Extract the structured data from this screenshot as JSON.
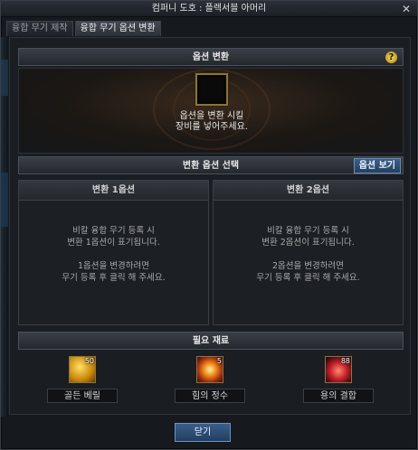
{
  "window": {
    "title": "컴퍼니 도호 : 플렉서블 아머리",
    "close_symbol": "✕"
  },
  "tabs": [
    {
      "label": "융합 무기 제작",
      "active": false
    },
    {
      "label": "융합 무기 옵션 변환",
      "active": true
    }
  ],
  "option_convert": {
    "title": "옵션 변환",
    "help_symbol": "?",
    "hint_line1": "옵션을 변환 시킬",
    "hint_line2": "장비를 넣어주세요."
  },
  "option_select": {
    "title": "변환 옵션 선택",
    "view_button": "옵션 보기",
    "boxes": [
      {
        "title": "변환 1옵션",
        "line1": "비칼 융합 무기 등록 시",
        "line2": "변환 1옵션이 표기됩니다.",
        "line3": "1옵션을 변경하려면",
        "line4": "무기 등록 후 클릭 해 주세요."
      },
      {
        "title": "변환 2옵션",
        "line1": "비칼 융합 무기 등록 시",
        "line2": "변환 2옵션이 표기됩니다.",
        "line3": "2옵션을 변경하려면",
        "line4": "무기 등록 후 클릭 해 주세요."
      }
    ]
  },
  "materials": {
    "title": "필요 재료",
    "items": [
      {
        "name": "골든 베릴",
        "count": "50",
        "icon": "golden-beryl-icon",
        "color": "#d9a515"
      },
      {
        "name": "힘의 정수",
        "count": "5",
        "icon": "essence-of-power-icon",
        "color": "#e0542a"
      },
      {
        "name": "용의 결합",
        "count": "88",
        "icon": "dragon-bond-icon",
        "color": "#b3262b"
      }
    ]
  },
  "footer": {
    "close_label": "닫기"
  }
}
